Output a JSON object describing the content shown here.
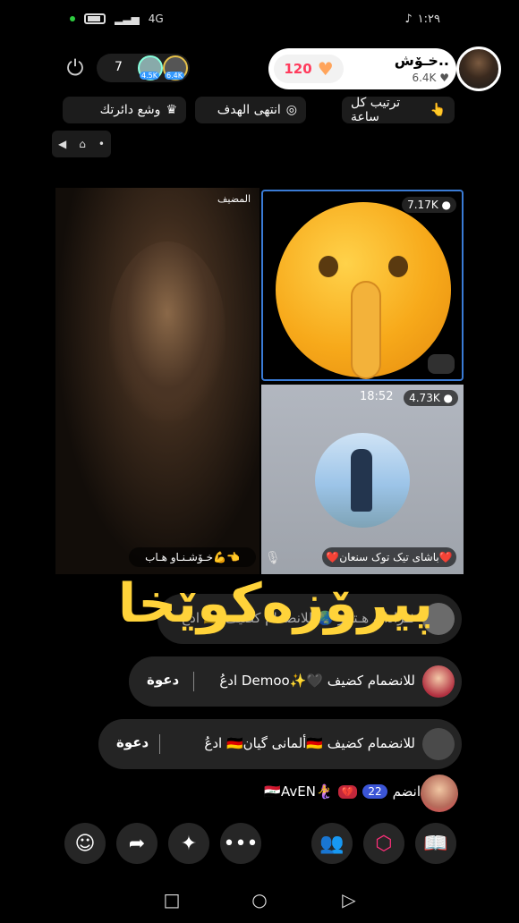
{
  "status_bar": {
    "time": "١:٢٩",
    "signal": "4G",
    "battery_icon": "battery-icon"
  },
  "host": {
    "name": "خـۆش..",
    "followers": "6.4K",
    "likes": "120"
  },
  "viewers": {
    "count": "7",
    "badge_1": "4.5K",
    "badge_2": "6.4K"
  },
  "chips": {
    "rank": "ترتيب كل ساعة",
    "goal": "انتهى الهدف",
    "mode": "وشع دائرتك"
  },
  "tiles": {
    "guest_label": "المضيف",
    "guest_name": "خـۆشـنـاو هـاب💪👈",
    "emoji_count": "7.17K",
    "user_time": "18:52",
    "user_count": "4.73K",
    "user_name": "❤️باشای تیک توک سنعان❤️"
  },
  "overlay_text": "پیرۆزەکوێخا",
  "chat": [
    {
      "text": "ادعُ 🇩🇪 فـرادانه هـتلـر 🌏 للانضمام كضيف",
      "invite": "دعوة"
    },
    {
      "text": "ادعُ Demoo✨🖤 للانضمام كضيف",
      "invite": "دعوة"
    },
    {
      "text": "ادعُ 🇩🇪ألمانی گیان🇩🇪 للانضمام كضيف",
      "invite": "دعوة"
    }
  ],
  "join": {
    "action": "انضم",
    "level": "22",
    "user": "🇮🇶AvEN🧜‍♀️"
  },
  "colors": {
    "overlay_yellow": "#ffd33a",
    "likes_red": "#ff3b5c",
    "toolbar_pink": "#ff2f7a",
    "toolbar_blue": "#3fd0ff"
  }
}
